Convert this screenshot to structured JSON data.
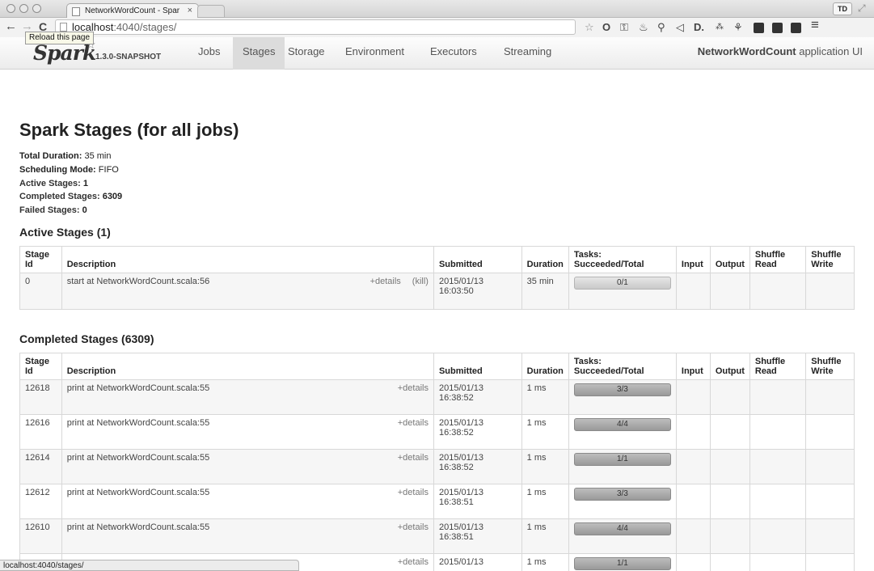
{
  "browser": {
    "tab_title": "NetworkWordCount - Spar",
    "tab_close": "×",
    "profile": "TD",
    "address_host": "localhost",
    "address_path": ":4040/stages/",
    "tooltip": "Reload this page",
    "status_url": "localhost:4040/stages/",
    "icons": [
      "back-icon",
      "forward-icon",
      "reload-icon",
      "page-icon",
      "star-icon",
      "extension-icon",
      "menu-icon"
    ]
  },
  "spark_nav": {
    "brand": "Spark",
    "version": "1.3.0-SNAPSHOT",
    "links": [
      "Jobs",
      "Stages",
      "Storage",
      "Environment",
      "Executors",
      "Streaming"
    ],
    "active": "Stages",
    "app_name": "NetworkWordCount",
    "app_suffix": " application UI"
  },
  "page": {
    "title": "Spark Stages (for all jobs)",
    "summary": {
      "total_duration_label": "Total Duration:",
      "total_duration": " 35 min",
      "scheduling_mode_label": "Scheduling Mode:",
      "scheduling_mode": " FIFO",
      "active_stages_label": "Active Stages:",
      "active_stages": " 1",
      "completed_stages_label": "Completed Stages:",
      "completed_stages": " 6309",
      "failed_stages_label": "Failed Stages:",
      "failed_stages": " 0"
    },
    "headers": {
      "stage_id": "Stage Id",
      "description": "Description",
      "submitted": "Submitted",
      "duration": "Duration",
      "tasks": "Tasks: Succeeded/Total",
      "input": "Input",
      "output": "Output",
      "shuffle_read": "Shuffle Read",
      "shuffle_write": "Shuffle Write"
    },
    "active": {
      "heading": "Active Stages (1)",
      "rows": [
        {
          "id": "0",
          "description": "start at NetworkWordCount.scala:56",
          "details": "+details",
          "kill": "(kill)",
          "submitted_date": "2015/01/13",
          "submitted_time": "16:03:50",
          "duration": "35 min",
          "tasks": "0/1",
          "progress": 0
        }
      ]
    },
    "completed": {
      "heading": "Completed Stages (6309)",
      "rows": [
        {
          "id": "12618",
          "description": "print at NetworkWordCount.scala:55",
          "details": "+details",
          "submitted_date": "2015/01/13",
          "submitted_time": "16:38:52",
          "duration": "1 ms",
          "tasks": "3/3",
          "progress": 1
        },
        {
          "id": "12616",
          "description": "print at NetworkWordCount.scala:55",
          "details": "+details",
          "submitted_date": "2015/01/13",
          "submitted_time": "16:38:52",
          "duration": "1 ms",
          "tasks": "4/4",
          "progress": 1
        },
        {
          "id": "12614",
          "description": "print at NetworkWordCount.scala:55",
          "details": "+details",
          "submitted_date": "2015/01/13",
          "submitted_time": "16:38:52",
          "duration": "1 ms",
          "tasks": "1/1",
          "progress": 1
        },
        {
          "id": "12612",
          "description": "print at NetworkWordCount.scala:55",
          "details": "+details",
          "submitted_date": "2015/01/13",
          "submitted_time": "16:38:51",
          "duration": "1 ms",
          "tasks": "3/3",
          "progress": 1
        },
        {
          "id": "12610",
          "description": "print at NetworkWordCount.scala:55",
          "details": "+details",
          "submitted_date": "2015/01/13",
          "submitted_time": "16:38:51",
          "duration": "1 ms",
          "tasks": "4/4",
          "progress": 1
        },
        {
          "id": "",
          "description": "",
          "details": "+details",
          "submitted_date": "2015/01/13",
          "submitted_time": "",
          "duration": "1 ms",
          "tasks": "1/1",
          "progress": 1
        }
      ]
    }
  }
}
